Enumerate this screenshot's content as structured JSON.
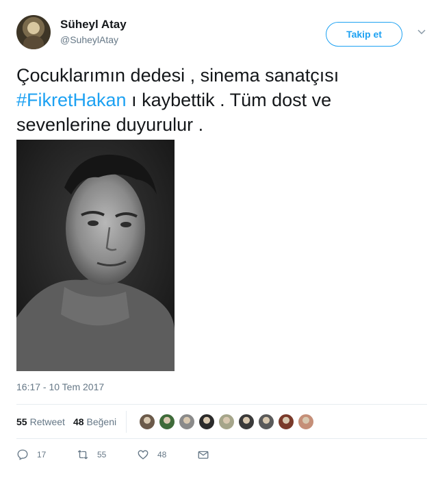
{
  "user": {
    "name": "Süheyl Atay",
    "handle": "@SuheylAtay",
    "follow_label": "Takip et"
  },
  "tweet": {
    "text_before": "Çocuklarımın dedesi , sinema sanatçısı ",
    "hashtag": "#FikretHakan",
    "text_after": " ı kaybettik . Tüm dost ve sevenlerine duyurulur .",
    "timestamp": "16:17 - 10 Tem 2017"
  },
  "stats": {
    "retweets_count": "55",
    "retweets_label": "Retweet",
    "likes_count": "48",
    "likes_label": "Beğeni"
  },
  "liker_colors": [
    "#6b5a4a",
    "#3f6b3a",
    "#8a8a8a",
    "#2b2b2b",
    "#a5a58a",
    "#3a3a3a",
    "#5a5a5a",
    "#7a3a2a",
    "#c58f78"
  ],
  "actions": {
    "reply_count": "17",
    "retweet_count": "55",
    "like_count": "48"
  }
}
